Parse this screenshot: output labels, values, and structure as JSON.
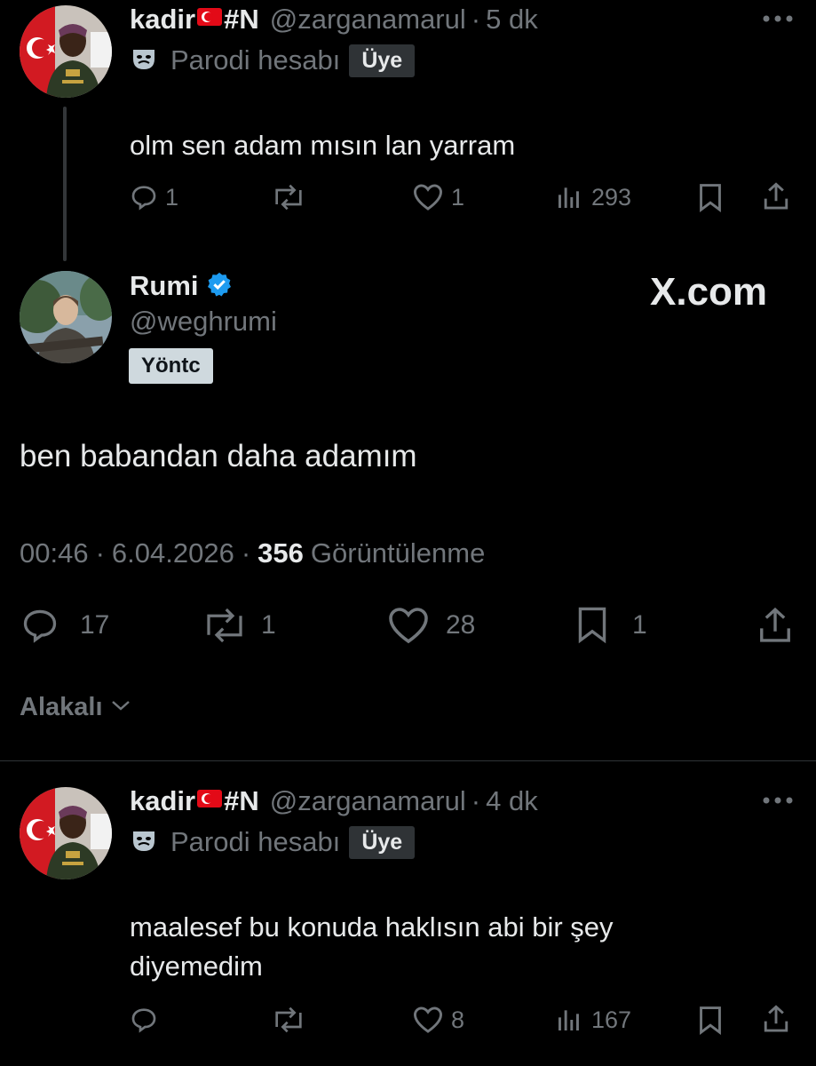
{
  "tweet1": {
    "name": "kadir",
    "name_suffix": "#N",
    "handle": "@zarganamarul",
    "separator": "·",
    "time": "5 dk",
    "parody_label": "Parodi hesabı",
    "member_badge": "Üye",
    "text": "olm sen adam mısın lan yarram",
    "replies": "1",
    "likes": "1",
    "views": "293",
    "more_icon": "more-horizontal-icon"
  },
  "main_tweet": {
    "name": "Rumi",
    "handle": "@weghrumi",
    "label_badge": "Yöntc",
    "watermark": "X.com",
    "text": "ben babandan daha adamım",
    "time": "00:46",
    "date": "6.04.2026",
    "views_count": "356",
    "views_label": "Görüntülenme",
    "dot": "·",
    "replies": "17",
    "reposts": "1",
    "likes": "28",
    "bookmarks": "1",
    "verified_color": "#1d9bf0"
  },
  "sort": {
    "label": "Alakalı"
  },
  "tweet2": {
    "name": "kadir",
    "name_suffix": "#N",
    "handle": "@zarganamarul",
    "separator": "·",
    "time": "4 dk",
    "parody_label": "Parodi hesabı",
    "member_badge": "Üye",
    "text_line1": "maalesef bu konuda haklısın abi bir şey",
    "text_line2": "diyemedim",
    "likes": "8",
    "views": "167"
  },
  "colors": {
    "background": "#000000",
    "text": "#e7e9ea",
    "secondary": "#71767b",
    "accent": "#1d9bf0"
  }
}
